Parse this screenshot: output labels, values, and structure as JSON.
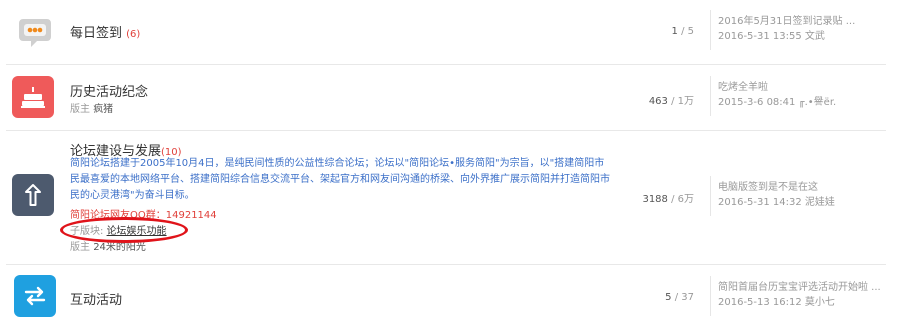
{
  "forums": [
    {
      "title": "每日签到",
      "count": "(6)",
      "stats_num": "1",
      "stats_total": " / 5",
      "last_title": "2016年5月31日签到记录贴 ...",
      "last_meta": "2016-5-31 13:55 文武",
      "icon": "chat-bubble-icon",
      "color": "#e0e0e0"
    },
    {
      "title": "历史活动纪念",
      "moderator_label": "版主",
      "moderator": "疯猪",
      "stats_num": "463",
      "stats_total": " / 1万",
      "last_title": "吃烤全羊啦",
      "last_meta": "2015-3-6 08:41 ╓.•譽ёr.",
      "icon": "cake-icon",
      "color": "#ef5a5a"
    },
    {
      "title": "论坛建设与发展",
      "count": "(10)",
      "description": "简阳论坛搭建于2005年10月4日，是纯民间性质的公益性综合论坛；论坛以\"简阳论坛•服务简阳\"为宗旨，以\"搭建简阳市民最喜爱的本地网络平台、搭建简阳综合信息交流平台、架起官方和网友间沟通的桥梁、向外界推广展示简阳并打造简阳市民的心灵港湾\"为奋斗目标。",
      "qq_group": "简阳论坛网友QQ群：14921144",
      "subforum_label": "子版块:",
      "subforum": "论坛娱乐功能",
      "moderator_label": "版主",
      "moderator": "24米的阳光",
      "stats_num": "3188",
      "stats_total": " / 6万",
      "last_title": "电脑版签到是不是在这",
      "last_meta": "2016-5-31 14:32 泥娃娃",
      "icon": "arrow-up-icon",
      "color": "#4d5a6e"
    },
    {
      "title": "互动活动",
      "stats_num": "5",
      "stats_total": " / 37",
      "last_title": "简阳首届台历宝宝评选活动开始啦 ...",
      "last_meta": "2016-5-13 16:12 莫小七",
      "icon": "exchange-arrows-icon",
      "color": "#1fa0e0"
    }
  ],
  "annotation_color": "#e0131a"
}
